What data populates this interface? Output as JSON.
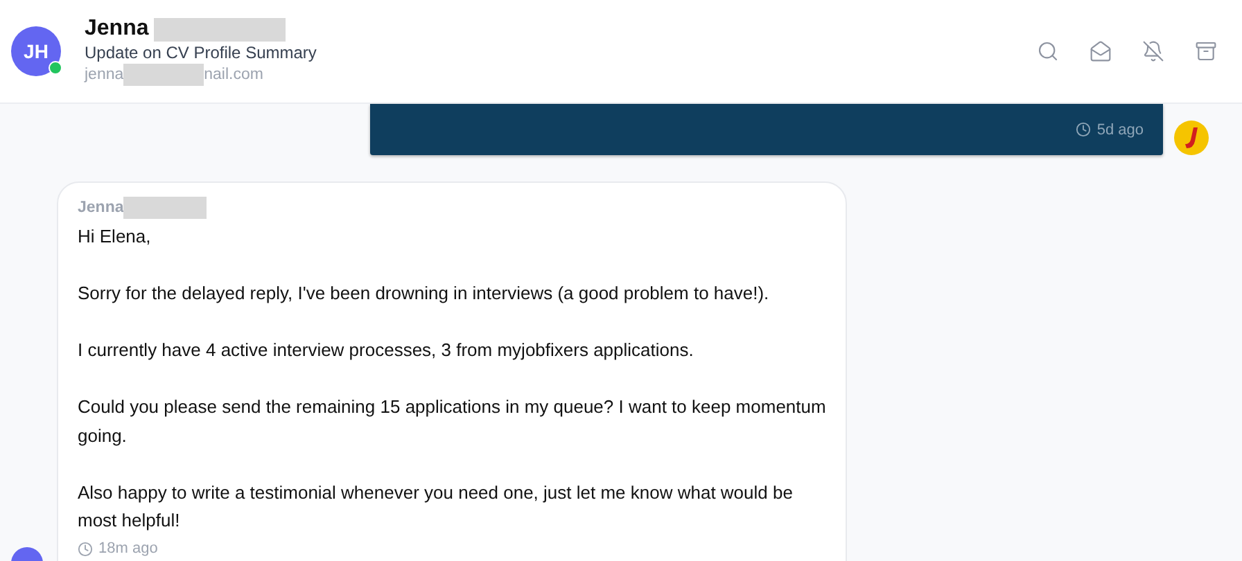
{
  "header": {
    "initials": "JH",
    "online": true,
    "name": "Jenna",
    "subject": "Update on CV Profile Summary",
    "email_start": "jenna",
    "email_end": "nail.com"
  },
  "messages": [
    {
      "kind": "outgoing",
      "time": "5d ago"
    },
    {
      "kind": "incoming",
      "sender": "Jenna",
      "paragraphs": [
        "Hi Elena,",
        "Sorry for the delayed reply, I've been drowning in interviews (a good problem to have!).",
        "I currently have 4 active interview processes, 3 from myjobfixers applications.",
        "Could you please send the remaining 15 applications in my queue? I want to keep momentum going.",
        "Also happy to write a testimonial whenever you need one, just let me know what would be most helpful!"
      ],
      "time": "18m ago"
    }
  ]
}
